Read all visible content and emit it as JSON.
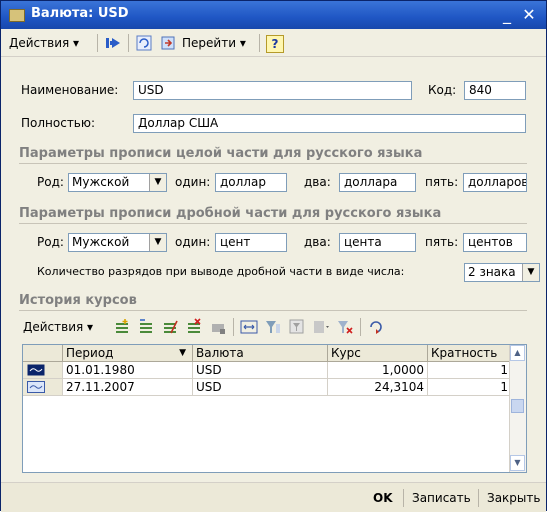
{
  "window": {
    "title": "Валюта: USD",
    "minimize": "_",
    "maximize": "□",
    "close": "✕"
  },
  "toolbar": {
    "actions_label": "Действия",
    "goto_label": "Перейти",
    "help_label": "?"
  },
  "form": {
    "name_label": "Наименование:",
    "name_value": "USD",
    "code_label": "Код:",
    "code_value": "840",
    "full_label": "Полностью:",
    "full_value": "Доллар США"
  },
  "integer_section": {
    "title": "Параметры прописи целой части для русского языка",
    "gender_label": "Род:",
    "gender_value": "Мужской",
    "one_label": "один:",
    "one_value": "доллар",
    "two_label": "два:",
    "two_value": "доллара",
    "five_label": "пять:",
    "five_value": "долларов"
  },
  "fraction_section": {
    "title": "Параметры прописи дробной части для русского языка",
    "gender_label": "Род:",
    "gender_value": "Мужской",
    "one_label": "один:",
    "one_value": "цент",
    "two_label": "два:",
    "two_value": "цента",
    "five_label": "пять:",
    "five_value": "центов",
    "digits_label": "Количество разрядов при выводе дробной части в виде числа:",
    "digits_value": "2 знака"
  },
  "history": {
    "title": "История курсов",
    "actions_label": "Действия",
    "columns": [
      "Период",
      "Валюта",
      "Курс",
      "Кратность"
    ],
    "rows": [
      {
        "period": "01.01.1980",
        "currency": "USD",
        "rate": "1,0000",
        "multiplier": "1"
      },
      {
        "period": "27.11.2007",
        "currency": "USD",
        "rate": "24,3104",
        "multiplier": "1"
      }
    ]
  },
  "footer": {
    "ok": "OK",
    "save": "Записать",
    "close": "Закрыть"
  },
  "colors": {
    "title_bar": "#1f56c4",
    "window_bg": "#f1efe2",
    "field_border": "#7f9db9",
    "section_title": "#808080"
  }
}
